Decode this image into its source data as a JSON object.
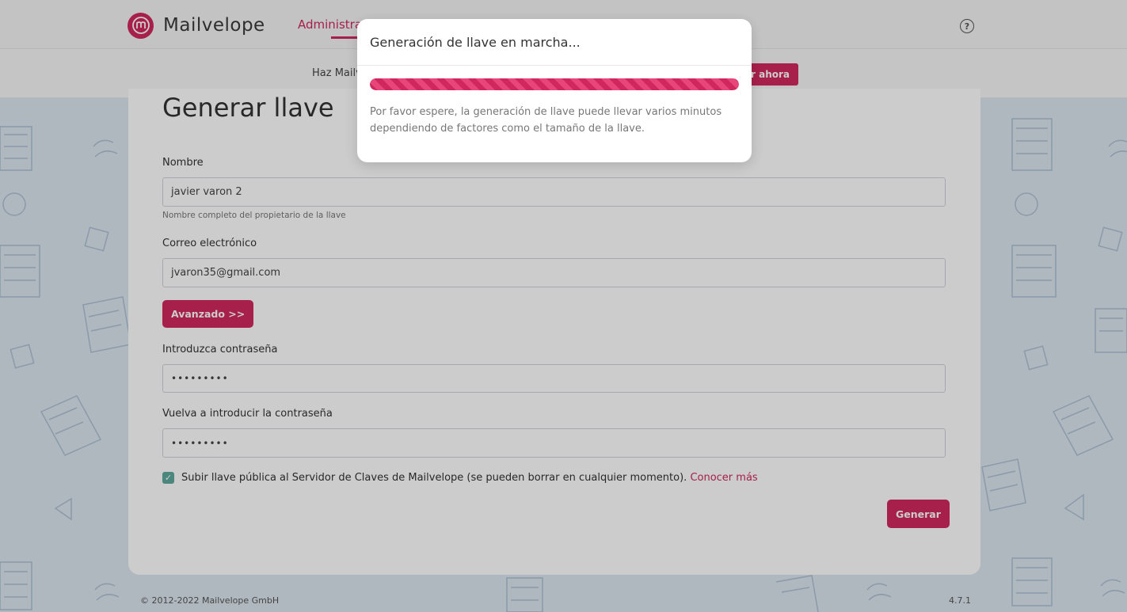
{
  "app": {
    "brand_name": "Mailvelope",
    "nav_active": "Administra",
    "promo_text": "Haz Mailv",
    "promo_button": "r ahora",
    "accent_color": "#d0285e"
  },
  "form": {
    "title": "Generar llave",
    "name_label": "Nombre",
    "name_value": "javier varon 2",
    "name_help": "Nombre completo del propietario de la llave",
    "email_label": "Correo electrónico",
    "email_value": "jvaron35@gmail.com",
    "advanced_button": "Avanzado >>",
    "password_label": "Introduzca contraseña",
    "password_value": "•••••••••",
    "password_confirm_label": "Vuelva a introducir la contraseña",
    "password_confirm_value": "•••••••••",
    "upload_checkbox_label": "Subir llave pública al Servidor de Claves de Mailvelope (se pueden borrar en cualquier momento).",
    "upload_checked": true,
    "learn_more": "Conocer más",
    "generate_button": "Generar"
  },
  "footer": {
    "copyright": "© 2012-2022  Mailvelope GmbH",
    "version": "4.7.1"
  },
  "modal": {
    "title": "Generación de llave en marcha...",
    "progress": 1.0,
    "body": "Por favor espere, la generación de llave puede llevar varios minutos dependiendo de factores como el tamaño de la llave."
  }
}
